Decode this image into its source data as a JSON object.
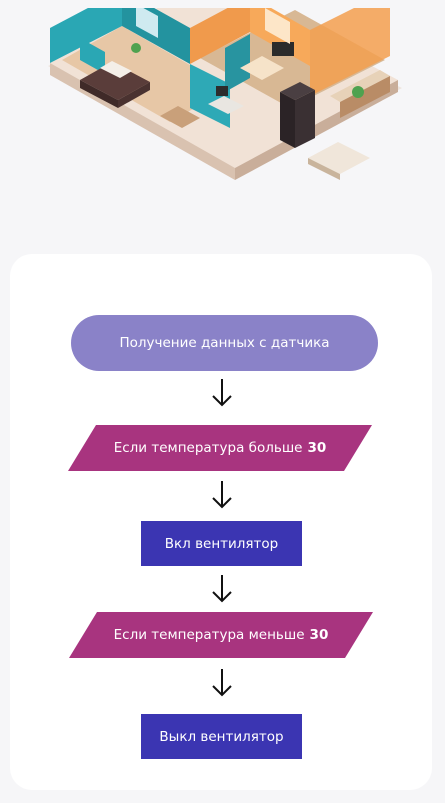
{
  "colors": {
    "background": "#f6f6f8",
    "card": "#ffffff",
    "terminal": "#8a82c8",
    "decision": "#a8347f",
    "process": "#3b35b2",
    "arrow": "#111111"
  },
  "illustration": {
    "icon": "isometric-apartment-illustration"
  },
  "flow": {
    "start": "Получение данных с датчика",
    "condition_high": {
      "text": "Если температура больше",
      "value": "30"
    },
    "action_on": "Вкл вентилятор",
    "condition_low": {
      "text": "Если температура меньше",
      "value": "30"
    },
    "action_off": "Выкл вентилятор"
  }
}
